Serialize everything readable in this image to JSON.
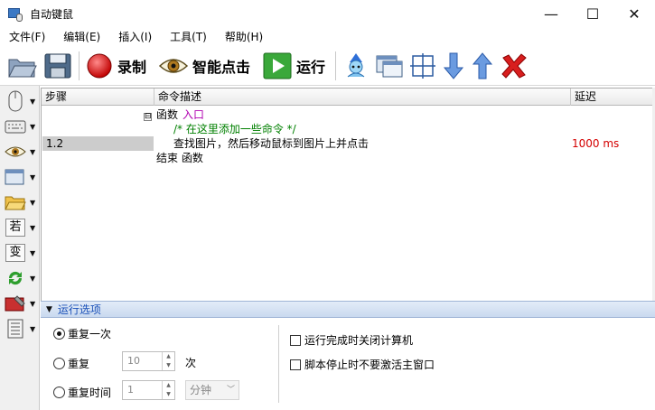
{
  "window": {
    "title": "自动键鼠",
    "minimize": "—",
    "maximize": "☐",
    "close": "✕"
  },
  "menu": [
    "文件(F)",
    "编辑(E)",
    "插入(I)",
    "工具(T)",
    "帮助(H)"
  ],
  "toolbar": {
    "record_label": "录制",
    "smart_click_label": "智能点击",
    "run_label": "运行"
  },
  "left_tools": {
    "if_char": "若",
    "var_char": "变"
  },
  "grid": {
    "columns": [
      "步骤",
      "命令描述",
      "延迟"
    ],
    "rows": [
      {
        "step": "",
        "tree": "⊟",
        "keyword": "函数",
        "name": "入口",
        "delay": ""
      },
      {
        "step": "",
        "comment": "/* 在这里添加一些命令 */",
        "delay": ""
      },
      {
        "step": "1.2",
        "command": "查找图片，然后移动鼠标到图片上并点击",
        "delay": "1000 ms"
      },
      {
        "step": "",
        "end": "结束 函数",
        "delay": ""
      }
    ]
  },
  "options": {
    "title": "运行选项",
    "repeat_once": "重复一次",
    "repeat": "重复",
    "repeat_count": "10",
    "repeat_unit": "次",
    "repeat_time": "重复时间",
    "time_value": "1",
    "time_unit": "分钟",
    "shutdown_label": "运行完成时关闭计算机",
    "no_activate_label": "脚本停止时不要激活主窗口"
  }
}
